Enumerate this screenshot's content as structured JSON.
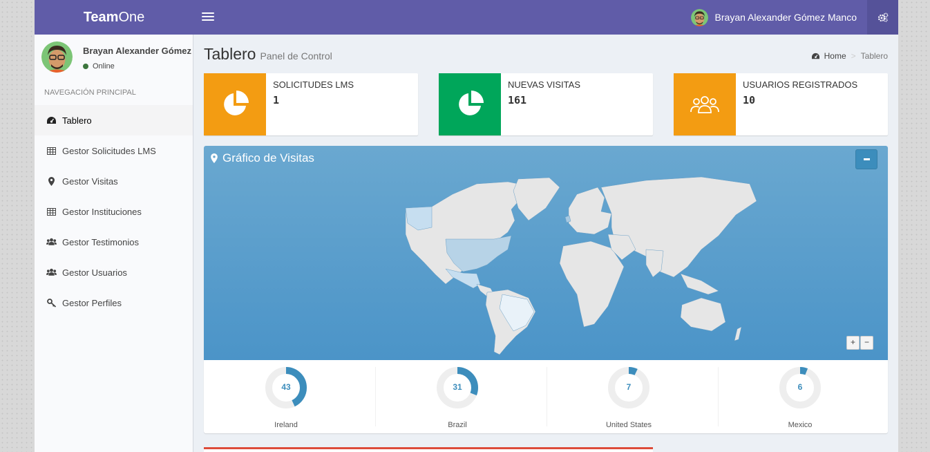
{
  "app": {
    "logo_bold": "Team",
    "logo_rest": "One"
  },
  "topbar": {
    "user_name": "Brayan Alexander Gómez Manco",
    "menu_icon": "bars-icon",
    "settings_icon": "gears-icon"
  },
  "sidebar": {
    "user_name": "Brayan Alexander Gómez Manco",
    "status": "Online",
    "nav_header": "NAVEGACIÓN PRINCIPAL",
    "items": [
      {
        "label": "Tablero",
        "icon": "dashboard-icon",
        "active": true
      },
      {
        "label": "Gestor Solicitudes LMS",
        "icon": "table-icon"
      },
      {
        "label": "Gestor Visitas",
        "icon": "map-marker-icon"
      },
      {
        "label": "Gestor Instituciones",
        "icon": "table-icon"
      },
      {
        "label": "Gestor Testimonios",
        "icon": "users-icon"
      },
      {
        "label": "Gestor Usuarios",
        "icon": "users-icon"
      },
      {
        "label": "Gestor Perfiles",
        "icon": "key-icon"
      }
    ]
  },
  "header": {
    "title": "Tablero",
    "subtitle": "Panel de Control",
    "breadcrumb": [
      {
        "label": "Home",
        "icon": "dashboard-icon"
      },
      {
        "label": "Tablero"
      }
    ]
  },
  "info_boxes": [
    {
      "label": "SOLICITUDES LMS",
      "value": "1",
      "color": "#f39c12",
      "icon": "pie-chart-icon"
    },
    {
      "label": "NUEVAS VISITAS",
      "value": "161",
      "color": "#00a65a",
      "icon": "pie-chart-icon"
    },
    {
      "label": "USUARIOS REGISTRADOS",
      "value": "10",
      "color": "#f39c12",
      "icon": "users-icon"
    }
  ],
  "map_box": {
    "title": "Gráfico de Visitas",
    "zoom_in": "+",
    "zoom_out": "−",
    "stats": [
      {
        "country": "Ireland",
        "value": "43",
        "percent": 43
      },
      {
        "country": "Brazil",
        "value": "31",
        "percent": 31
      },
      {
        "country": "United States",
        "value": "7",
        "percent": 7
      },
      {
        "country": "Mexico",
        "value": "6",
        "percent": 6
      }
    ]
  },
  "colors": {
    "primary": "#605ca8",
    "accent_blue": "#3c8dbc",
    "donut": "#3c8dbc",
    "danger": "#dd4b39"
  }
}
